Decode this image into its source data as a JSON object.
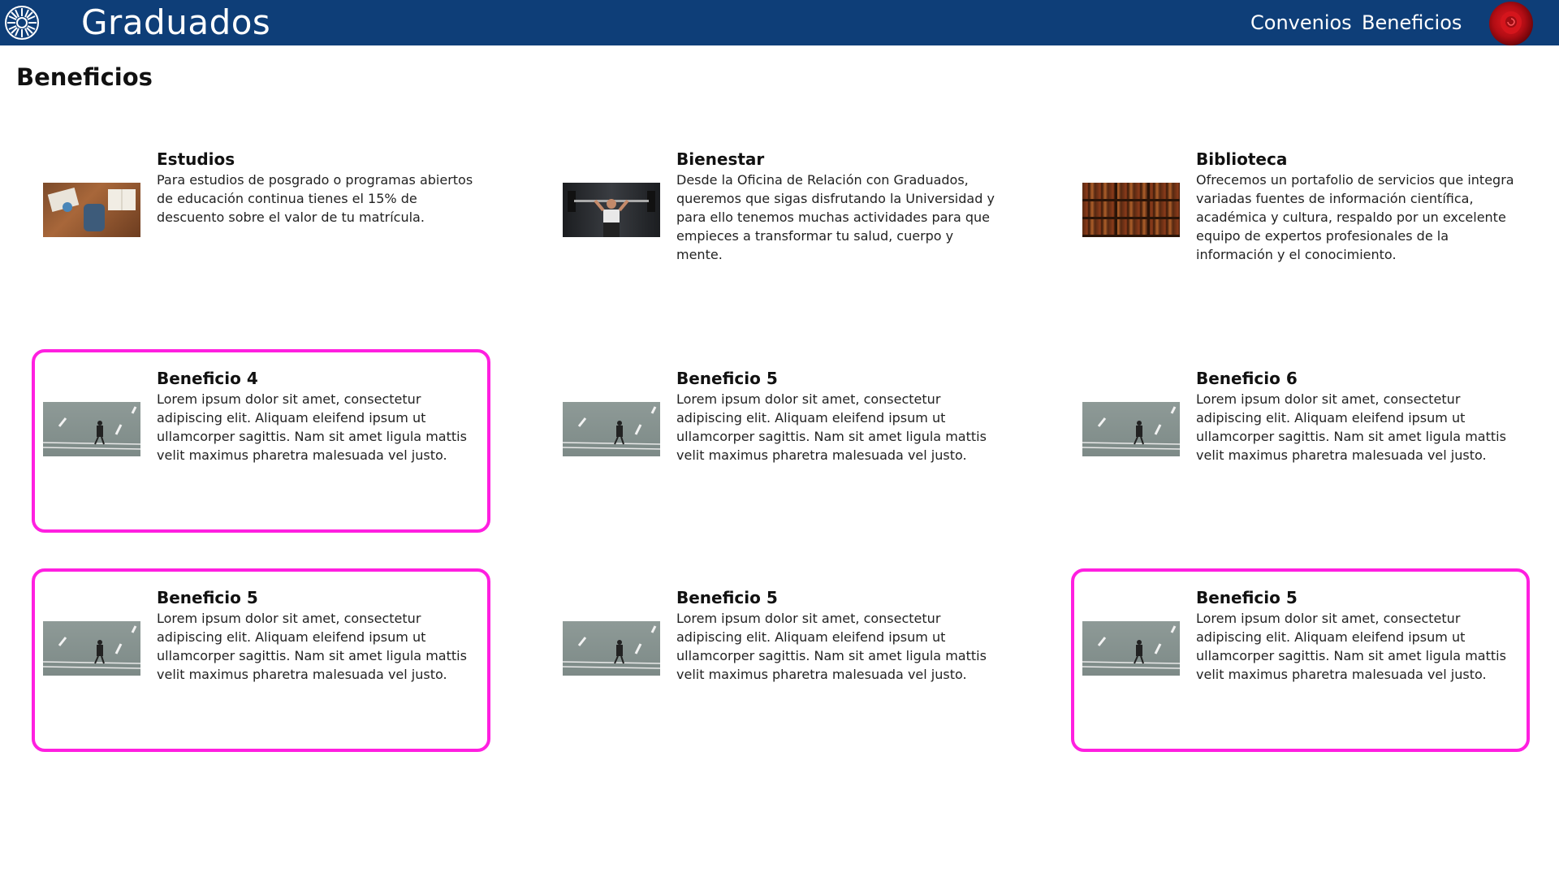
{
  "header": {
    "brand": "Graduados",
    "nav": [
      "Convenios",
      "Beneficios"
    ]
  },
  "page": {
    "title": "Beneficios"
  },
  "cards": [
    {
      "title": "Estudios",
      "description": "Para estudios de posgrado o programas abiertos de educación continua tienes el 15% de descuento sobre el valor de tu matrícula.",
      "highlighted": false,
      "image": "books-backpack-photo"
    },
    {
      "title": "Bienestar",
      "description": "Desde la Oficina de Relación con Graduados, queremos que sigas disfrutando la Universidad y para ello tenemos muchas actividades para que empieces a transformar tu salud, cuerpo y mente.",
      "highlighted": false,
      "image": "gym-weightlifting-photo"
    },
    {
      "title": "Biblioteca",
      "description": "Ofrecemos un portafolio de servicios que integra variadas fuentes de información científica, académica y cultura, respaldo por un excelente equipo de expertos profesionales de la información y el conocimiento.",
      "highlighted": false,
      "image": "bookshelf-photo"
    },
    {
      "title": "Beneficio 4",
      "description": "Lorem ipsum dolor sit amet, consectetur adipiscing elit. Aliquam eleifend ipsum ut ullamcorper sagittis. Nam sit amet ligula mattis velit maximus pharetra malesuada vel justo.",
      "highlighted": true,
      "image": "person-crossing-road-photo"
    },
    {
      "title": "Beneficio 5",
      "description": "Lorem ipsum dolor sit amet, consectetur adipiscing elit. Aliquam eleifend ipsum ut ullamcorper sagittis. Nam sit amet ligula mattis velit maximus pharetra malesuada vel justo.",
      "highlighted": false,
      "image": "person-crossing-road-photo"
    },
    {
      "title": "Beneficio 6",
      "description": "Lorem ipsum dolor sit amet, consectetur adipiscing elit. Aliquam eleifend ipsum ut ullamcorper sagittis. Nam sit amet ligula mattis velit maximus pharetra malesuada vel justo.",
      "highlighted": false,
      "image": "person-crossing-road-photo"
    },
    {
      "title": "Beneficio 5",
      "description": "Lorem ipsum dolor sit amet, consectetur adipiscing elit. Aliquam eleifend ipsum ut ullamcorper sagittis. Nam sit amet ligula mattis velit maximus pharetra malesuada vel justo.",
      "highlighted": true,
      "image": "person-crossing-road-photo"
    },
    {
      "title": "Beneficio 5",
      "description": "Lorem ipsum dolor sit amet, consectetur adipiscing elit. Aliquam eleifend ipsum ut ullamcorper sagittis. Nam sit amet ligula mattis velit maximus pharetra malesuada vel justo.",
      "highlighted": false,
      "image": "person-crossing-road-photo"
    },
    {
      "title": "Beneficio 5",
      "description": "Lorem ipsum dolor sit amet, consectetur adipiscing elit. Aliquam eleifend ipsum ut ullamcorper sagittis. Nam sit amet ligula mattis velit maximus pharetra malesuada vel justo.",
      "highlighted": true,
      "image": "person-crossing-road-photo"
    }
  ],
  "colors": {
    "navbar": "#0e3e78",
    "highlight_border": "#ff1fe0"
  }
}
